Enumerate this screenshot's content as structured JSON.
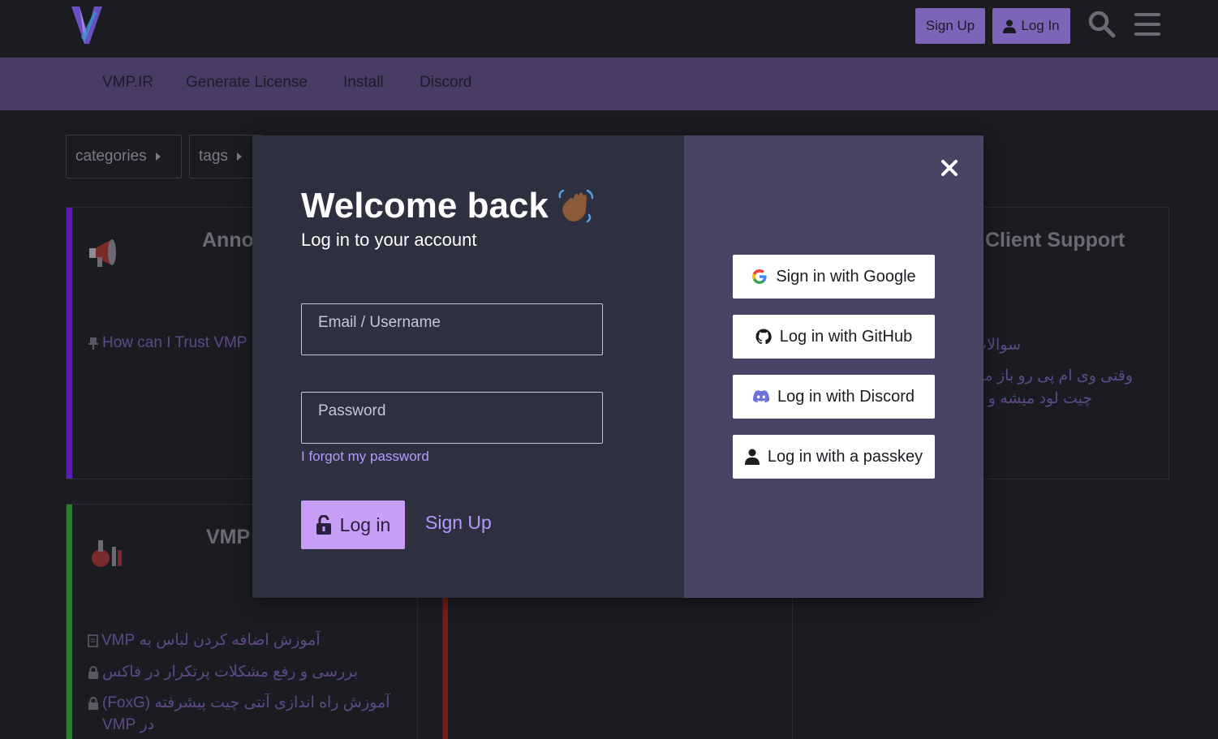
{
  "header": {
    "signup_label": "Sign Up",
    "login_label": "Log In"
  },
  "nav": {
    "links": [
      "VMP.IR",
      "Generate License",
      "Install",
      "Discord"
    ]
  },
  "background": {
    "filters": [
      "categories",
      "tags"
    ],
    "categories": [
      {
        "title": "Anno",
        "color": "#5a1fb0",
        "topics": [
          "How can I Trust VMP"
        ]
      },
      {
        "title": "Client Support",
        "topics": [
          "سوالات",
          "وقتی وی ام پی رو باز میکنم",
          "چیت لود میشه و"
        ]
      },
      {
        "title": "VMP",
        "color": "#2e7d32",
        "topics": [
          "آموزش اضافه کردن لباس به VMP",
          "بررسی و رفع مشکلات پرتکرار در فاکس",
          "آموزش راه اندازی آنتی چیت پیشرفته (FoxG)",
          "در VMP"
        ]
      }
    ]
  },
  "modal": {
    "title": "Welcome back",
    "subtitle": "Log in to your account",
    "email_placeholder": "Email / Username",
    "password_placeholder": "Password",
    "forgot_label": "I forgot my password",
    "login_label": "Log in",
    "signup_label": "Sign Up",
    "social": [
      {
        "label": "Sign in with Google",
        "icon": "google-icon"
      },
      {
        "label": "Log in with GitHub",
        "icon": "github-icon"
      },
      {
        "label": "Log in with Discord",
        "icon": "discord-icon"
      },
      {
        "label": "Log in with a passkey",
        "icon": "user-icon"
      }
    ]
  },
  "colors": {
    "accent": "#7d64b8",
    "navbar": "#4a3a66",
    "modal_left": "#2e2f3f",
    "modal_right": "#4a4363",
    "primary_button": "#c79ff7",
    "link": "#b49aff"
  }
}
